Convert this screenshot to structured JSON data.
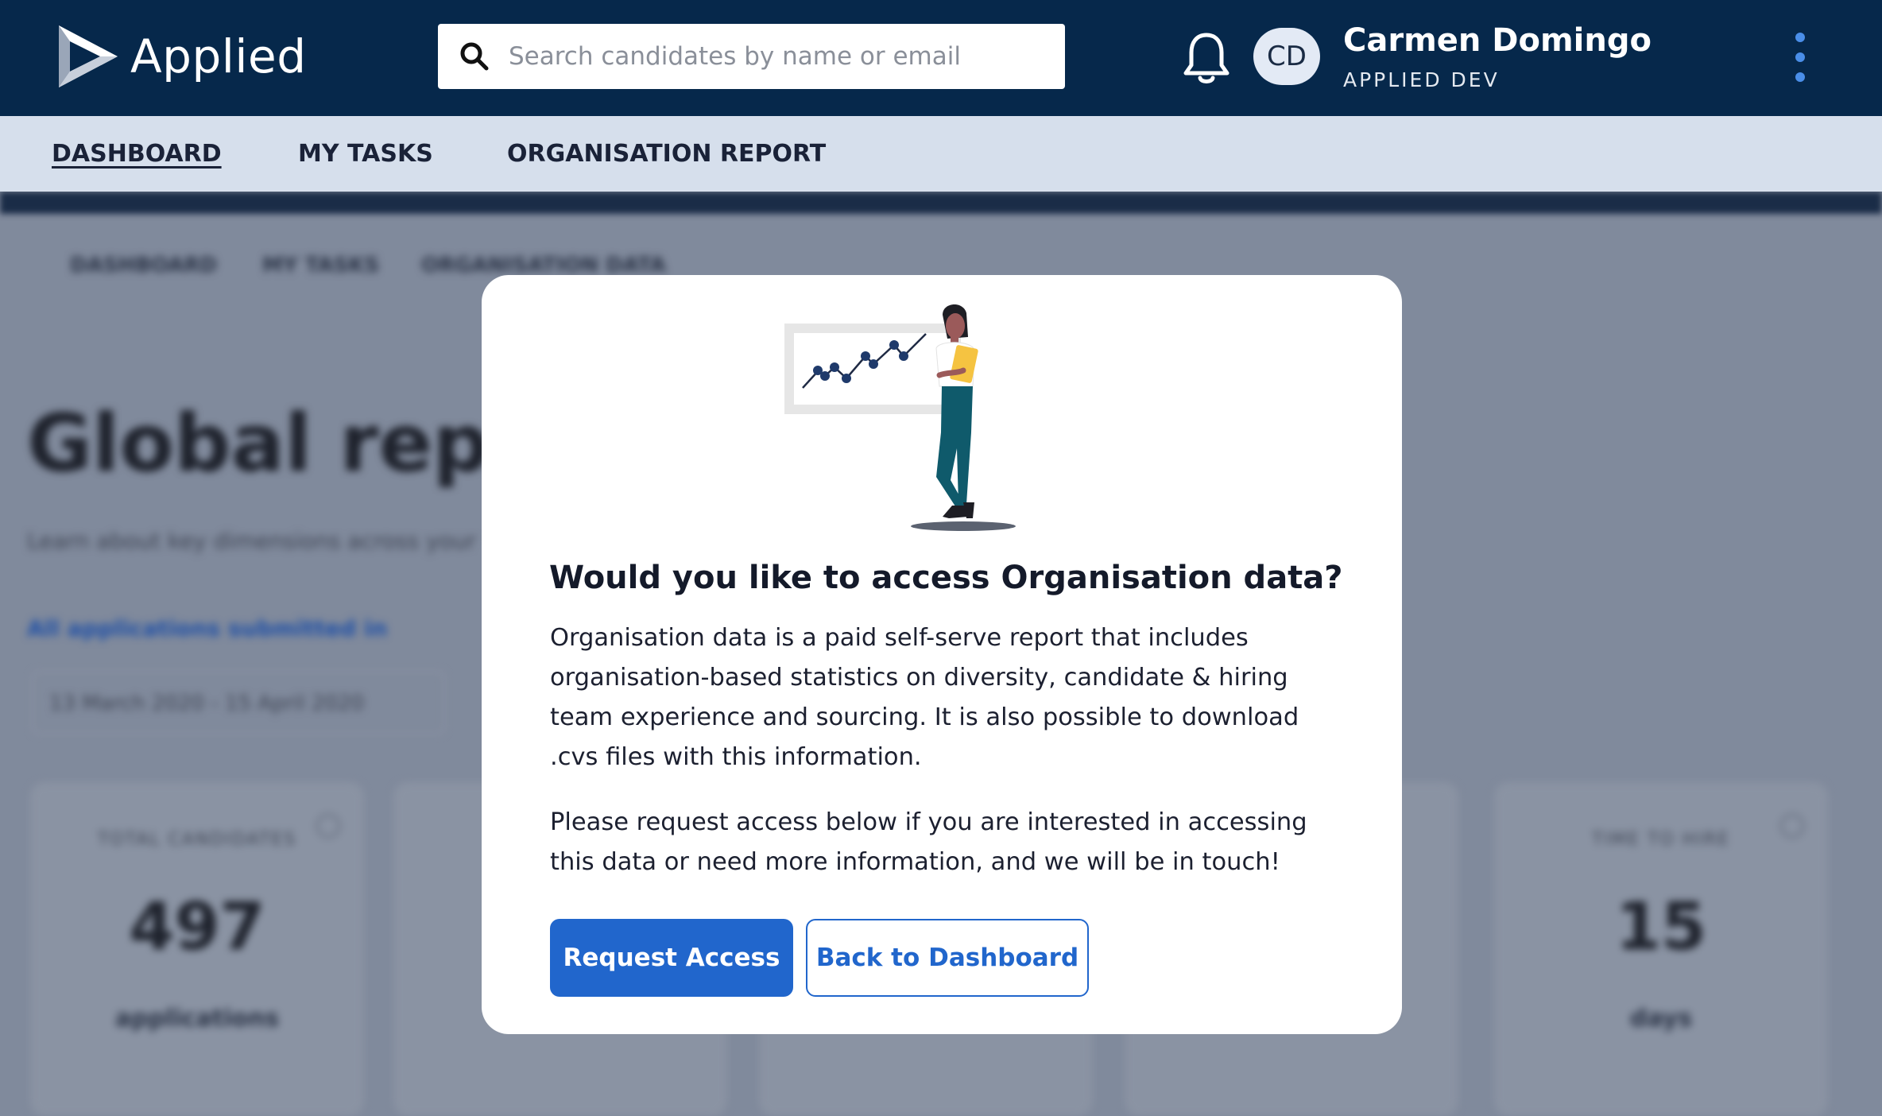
{
  "header": {
    "logo_text": "Applied",
    "search_placeholder": "Search candidates by name or email",
    "user": {
      "initials": "CD",
      "name": "Carmen Domingo",
      "org": "APPLIED DEV"
    }
  },
  "nav": {
    "tabs": [
      {
        "label": "DASHBOARD",
        "active": true
      },
      {
        "label": "MY TASKS",
        "active": false
      },
      {
        "label": "ORGANISATION REPORT",
        "active": false
      }
    ]
  },
  "background_page": {
    "tabs": [
      "DASHBOARD",
      "MY TASKS",
      "ORGANISATION DATA"
    ],
    "title": "Global report",
    "subtitle": "Learn about key dimensions across your",
    "filter_link": "All applications submitted in",
    "date_range": "13 March 2020 - 15 April 2020",
    "cards": [
      {
        "label": "TOTAL CANDIDATES",
        "value": "497",
        "unit": "applications"
      },
      {
        "label": "TIME TO HIRE",
        "value": "15",
        "unit": "days"
      }
    ]
  },
  "modal": {
    "title": "Would you like to access Organisation data?",
    "paragraph1": "Organisation data is a paid self-serve report that includes organisation-based statistics on diversity, candidate & hiring team experience and sourcing. It is also possible to download .cvs files with this information.",
    "paragraph2": "Please request access below if you are interested in accessing this data or need more information, and we will be in touch!",
    "primary_button": "Request Access",
    "secondary_button": "Back to Dashboard"
  },
  "colors": {
    "header_bg": "#06284b",
    "nav_bg": "#d6dfec",
    "primary": "#2166cc",
    "accent_dots": "#4a8ee8"
  },
  "icons": [
    "logo-icon",
    "search-icon",
    "bell-icon",
    "more-vertical-icon",
    "presentation-illustration"
  ]
}
